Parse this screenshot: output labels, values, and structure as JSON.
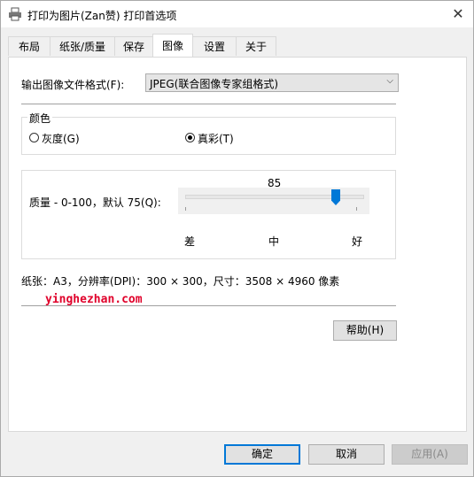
{
  "window": {
    "title": "打印为图片(Zan赞) 打印首选项",
    "close_glyph": "✕"
  },
  "tabs": [
    {
      "label": "布局"
    },
    {
      "label": "纸张/质量"
    },
    {
      "label": "保存"
    },
    {
      "label": "图像"
    },
    {
      "label": "设置"
    },
    {
      "label": "关于"
    }
  ],
  "active_tab": "图像",
  "format": {
    "label": "输出图像文件格式(F):",
    "value": "JPEG(联合图像专家组格式)"
  },
  "color": {
    "legend": "颜色",
    "grayscale_label": "灰度(G)",
    "truecolor_label": "真彩(T)",
    "selected": "truecolor"
  },
  "quality": {
    "label": "质量 - 0-100，默认 75(Q):",
    "value": 85,
    "value_text": "85",
    "min": 0,
    "max": 100,
    "low_label": "差",
    "mid_label": "中",
    "high_label": "好"
  },
  "paper_info": "纸张：A3，分辨率(DPI)：300 × 300，尺寸：3508 × 4960 像素",
  "watermark": "yinghezhan.com",
  "buttons": {
    "help": "帮助(H)",
    "ok": "确定",
    "cancel": "取消",
    "apply": "应用(A)"
  },
  "colors": {
    "accent": "#0078d7",
    "watermark": "#e0002a"
  }
}
